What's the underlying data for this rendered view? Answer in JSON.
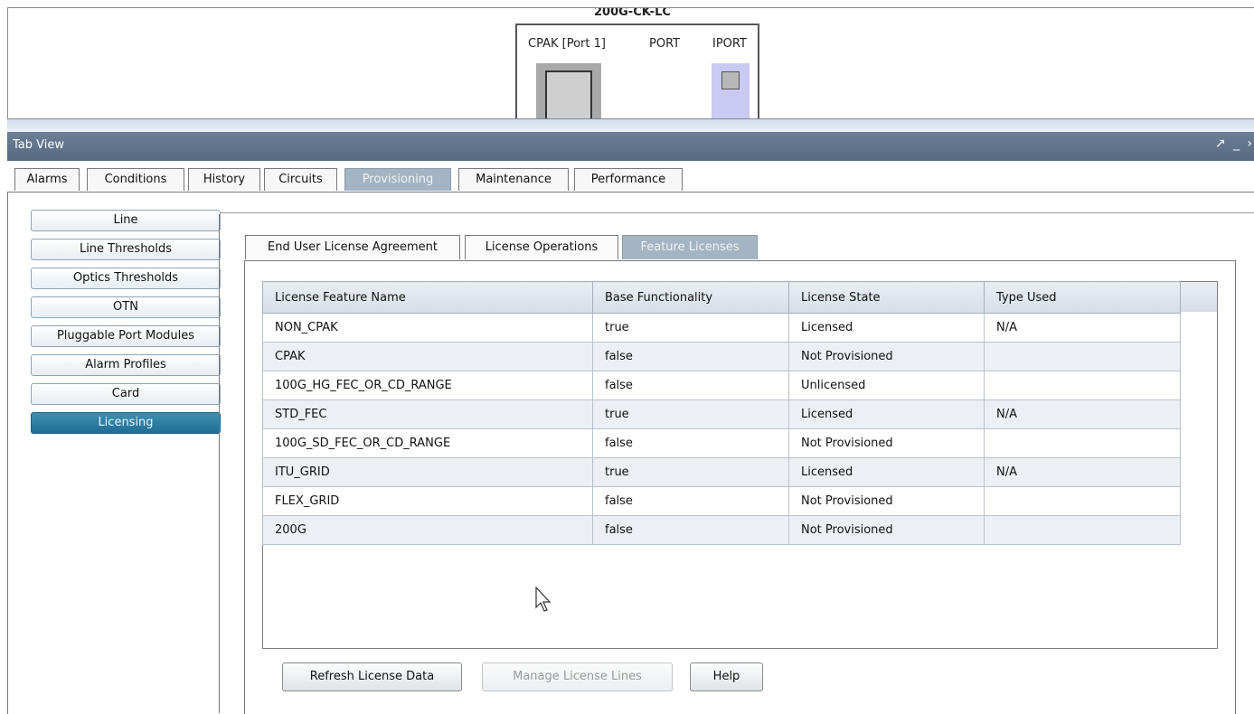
{
  "card": {
    "title": "200G-CK-LC",
    "ports": [
      "CPAK [Port 1]",
      "PORT",
      "IPORT"
    ]
  },
  "tab_view": {
    "title": "Tab View",
    "window_controls": [
      "↗",
      "_",
      "›"
    ]
  },
  "main_tabs": [
    {
      "label": "Alarms"
    },
    {
      "label": "Conditions"
    },
    {
      "label": "History"
    },
    {
      "label": "Circuits"
    },
    {
      "label": "Provisioning",
      "active": true
    },
    {
      "label": "Maintenance"
    },
    {
      "label": "Performance"
    }
  ],
  "nav_items": [
    {
      "label": "Line"
    },
    {
      "label": "Line Thresholds"
    },
    {
      "label": "Optics Thresholds"
    },
    {
      "label": "OTN"
    },
    {
      "label": "Pluggable Port Modules"
    },
    {
      "label": "Alarm Profiles"
    },
    {
      "label": "Card"
    },
    {
      "label": "Licensing",
      "active": true
    }
  ],
  "sub_tabs": [
    {
      "label": "End User License Agreement"
    },
    {
      "label": "License Operations"
    },
    {
      "label": "Feature Licenses",
      "active": true
    }
  ],
  "table": {
    "columns": [
      "License Feature Name",
      "Base Functionality",
      "License State",
      "Type Used"
    ],
    "rows": [
      [
        "NON_CPAK",
        "true",
        "Licensed",
        "N/A"
      ],
      [
        "CPAK",
        "false",
        "Not Provisioned",
        ""
      ],
      [
        "100G_HG_FEC_OR_CD_RANGE",
        "false",
        "Unlicensed",
        ""
      ],
      [
        "STD_FEC",
        "true",
        "Licensed",
        "N/A"
      ],
      [
        "100G_SD_FEC_OR_CD_RANGE",
        "false",
        "Not Provisioned",
        ""
      ],
      [
        "ITU_GRID",
        "true",
        "Licensed",
        "N/A"
      ],
      [
        "FLEX_GRID",
        "false",
        "Not Provisioned",
        ""
      ],
      [
        "200G",
        "false",
        "Not Provisioned",
        ""
      ]
    ]
  },
  "buttons": {
    "refresh": "Refresh License Data",
    "manage": "Manage License Lines",
    "help": "Help"
  },
  "colors": {
    "header_bar": "#566a82",
    "active_tab": "#a3b4c4",
    "active_nav": "#1f6f95",
    "iport_slot": "#c9c9f2"
  }
}
